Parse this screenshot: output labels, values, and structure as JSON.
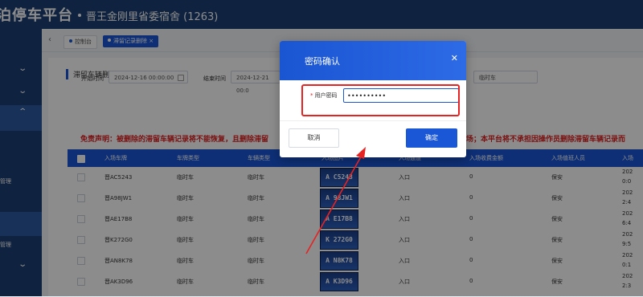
{
  "header": {
    "brand": "泊停车平台",
    "site": "晋王金刚里省委宿舍 (1263)"
  },
  "sidebar": {
    "items": [
      {
        "label": "管理"
      },
      {
        "label": "管理"
      }
    ]
  },
  "tabs": [
    {
      "label": "控制台"
    },
    {
      "label": "滞留记录删除"
    }
  ],
  "page": {
    "title": "滞留车辆删除"
  },
  "filters": {
    "start_label": "开始时间",
    "start_value": "2024-12-16 00:00:00",
    "end_label": "结束时间",
    "end_value": "2024-12-21 00:0",
    "type_value": "临时车"
  },
  "disclaimer": "免责声明：被删除的滞留车辆记录将不能恢复，且删除滞留",
  "disclaimer_tail": "场；本平台将不承担因操作员删除滞留车辆记录而",
  "table": {
    "headers": [
      "入场车牌",
      "车牌类型",
      "车辆类型",
      "入场图片",
      "入场通道",
      "入场收费金额",
      "入场值班人员",
      "入场"
    ],
    "rows": [
      {
        "plate": "晋AC5243",
        "plate_type": "临时车",
        "vehicle_type": "临时车",
        "img": "A C5243",
        "gate": "入口",
        "fee": "0",
        "staff": "保安",
        "time1": "202",
        "time2": "0:0"
      },
      {
        "plate": "晋A98JW1",
        "plate_type": "临时车",
        "vehicle_type": "临时车",
        "img": "A 98JW1",
        "gate": "入口",
        "fee": "0",
        "staff": "保安",
        "time1": "202",
        "time2": "2:4"
      },
      {
        "plate": "晋AE17B8",
        "plate_type": "临时车",
        "vehicle_type": "临时车",
        "img": "A E17B8",
        "gate": "入口",
        "fee": "0",
        "staff": "保安",
        "time1": "202",
        "time2": "6:4"
      },
      {
        "plate": "晋K272G0",
        "plate_type": "临时车",
        "vehicle_type": "临时车",
        "img": "K 272G0",
        "gate": "入口",
        "fee": "0",
        "staff": "保安",
        "time1": "202",
        "time2": "9:5"
      },
      {
        "plate": "晋AN8K78",
        "plate_type": "临时车",
        "vehicle_type": "临时车",
        "img": "A N8K78",
        "gate": "入口",
        "fee": "0",
        "staff": "保安",
        "time1": "202",
        "time2": "0:1"
      },
      {
        "plate": "晋AK3D96",
        "plate_type": "临时车",
        "vehicle_type": "临时车",
        "img": "A K3D96",
        "gate": "入口",
        "fee": "0",
        "staff": "保安",
        "time1": "202",
        "time2": "2:3"
      }
    ]
  },
  "dialog": {
    "title": "密码确认",
    "field_label": "用户密码",
    "password_value": "••••••••••",
    "cancel_label": "取消",
    "confirm_label": "确定"
  },
  "colors": {
    "accent": "#1a57d6",
    "header_bg": "#1d3f74",
    "warning": "#e02020",
    "annotation": "#e62222"
  }
}
